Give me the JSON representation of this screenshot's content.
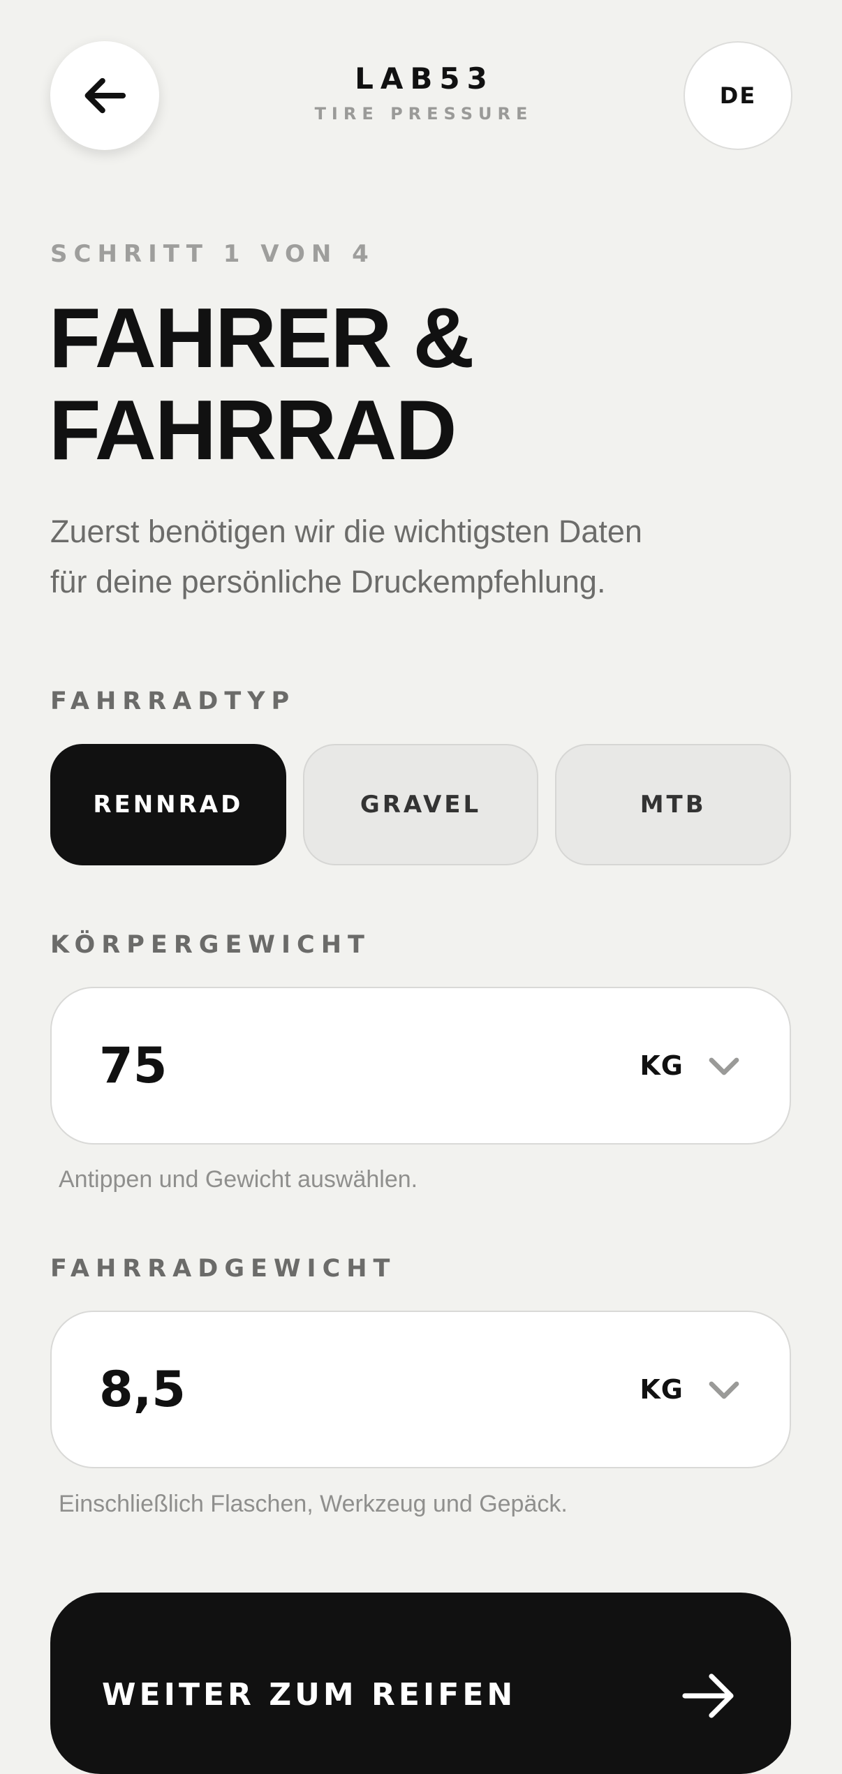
{
  "header": {
    "brand_title": "LAB53",
    "brand_subtitle": "TIRE PRESSURE",
    "language": "DE",
    "back_icon": "arrow-left-icon"
  },
  "step": {
    "label": "SCHRITT 1 VON 4",
    "current": 1,
    "total": 4,
    "title_line1": "FAHRER &",
    "title_line2": "FAHRRAD",
    "intro_line1": "Zuerst benötigen wir die wichtigsten Daten",
    "intro_line2": "für deine persönliche Druckempfehlung."
  },
  "bike_type": {
    "label": "FAHRRADTYP",
    "options": [
      "RENNRAD",
      "GRAVEL",
      "MTB"
    ],
    "selected": "RENNRAD"
  },
  "body_weight": {
    "label": "KÖRPERGEWICHT",
    "value": "75",
    "unit": "KG",
    "hint": "Antippen und Gewicht auswählen.",
    "icon": "chevron-down-icon"
  },
  "bike_weight": {
    "label": "FAHRRADGEWICHT",
    "value": "8,5",
    "unit": "KG",
    "hint": "Einschließlich Flaschen, Werkzeug und Gepäck.",
    "icon": "chevron-down-icon"
  },
  "cta": {
    "label": "WEITER ZUM REIFEN",
    "icon": "arrow-right-icon"
  },
  "colors": {
    "background": "#f2f2ef",
    "primary": "#111111",
    "muted": "#9e9e9c",
    "surface": "#ffffff"
  }
}
